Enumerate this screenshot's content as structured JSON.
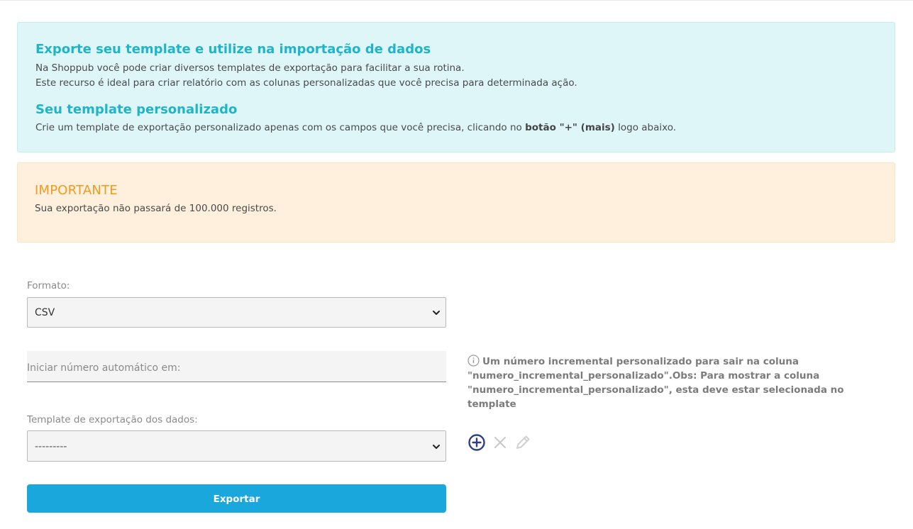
{
  "info": {
    "title1": "Exporte seu template e utilize na importação de dados",
    "line1": "Na Shoppub você pode criar diversos templates de exportação para facilitar a sua rotina.",
    "line2": "Este recurso é ideal para criar relatório com as colunas personalizadas que você precisa para determinada ação.",
    "title2": "Seu template personalizado",
    "line3_prefix": "Crie um template de exportação personalizado apenas com os campos que você precisa, clicando no ",
    "line3_bold": "botão \"+\" (mais)",
    "line3_suffix": " logo abaixo."
  },
  "warning": {
    "title": "IMPORTANTE",
    "text": "Sua exportação não passará de 100.000 registros."
  },
  "form": {
    "format_label": "Formato:",
    "format_value": "CSV",
    "auto_number_placeholder": "Iniciar número automático em:",
    "auto_number_hint": "Um número incremental personalizado para sair na coluna \"numero_incremental_personalizado\".Obs: Para mostrar a coluna \"numero_incremental_personalizado\", esta deve estar selecionada no template",
    "template_label": "Template de exportação dos dados:",
    "template_value": "---------",
    "export_button": "Exportar"
  },
  "icons": {
    "add": "plus-circle-icon",
    "remove": "close-icon",
    "edit": "pencil-icon"
  },
  "colors": {
    "info_title": "#1fb5c9",
    "info_bg": "#dff6f8",
    "warning_title": "#f39a1e",
    "warning_bg": "#fef0dd",
    "primary_button": "#1aa8dc",
    "add_icon": "#2c3e8f"
  }
}
